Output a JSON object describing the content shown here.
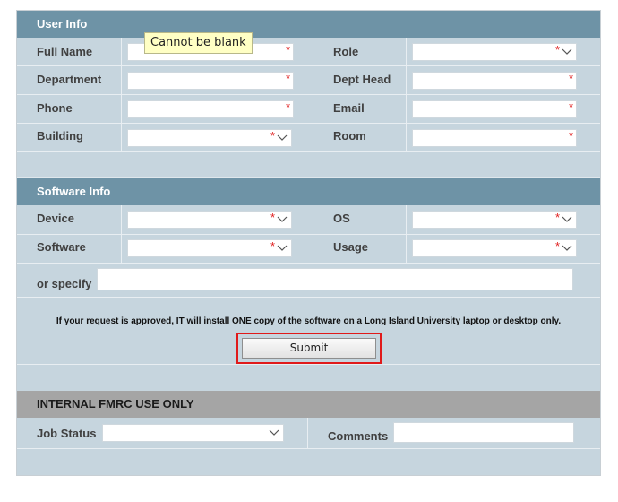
{
  "tooltip": "Cannot be blank",
  "sections": {
    "user_info": "User Info",
    "software_info": "Software Info",
    "internal": "INTERNAL FMRC USE ONLY"
  },
  "user_info": {
    "full_name": {
      "label": "Full Name",
      "value": "",
      "required": "*"
    },
    "role": {
      "label": "Role",
      "value": "",
      "required": "*"
    },
    "department": {
      "label": "Department",
      "value": "",
      "required": "*"
    },
    "dept_head": {
      "label": "Dept Head",
      "value": "",
      "required": "*"
    },
    "phone": {
      "label": "Phone",
      "value": "",
      "required": "*"
    },
    "email": {
      "label": "Email",
      "value": "",
      "required": "*"
    },
    "building": {
      "label": "Building",
      "value": "",
      "required": "*"
    },
    "room": {
      "label": "Room",
      "value": "",
      "required": "*"
    }
  },
  "software_info": {
    "device": {
      "label": "Device",
      "value": "",
      "required": "*"
    },
    "os": {
      "label": "OS",
      "value": "",
      "required": "*"
    },
    "software": {
      "label": "Software",
      "value": "",
      "required": "*"
    },
    "usage": {
      "label": "Usage",
      "value": "",
      "required": "*"
    },
    "or_specify": {
      "label": "or specify",
      "value": ""
    }
  },
  "notice": "If your request is approved, IT will install ONE copy of the software on a Long Island University laptop or desktop only.",
  "submit_label": "Submit",
  "internal": {
    "job_status": {
      "label": "Job Status",
      "value": ""
    },
    "comments": {
      "label": "Comments",
      "value": ""
    }
  },
  "colors": {
    "header": "#6e93a6",
    "internal_header": "#a5a5a5",
    "form_bg": "#c6d5de",
    "required": "#e02020",
    "highlight": "#e01a1a"
  }
}
